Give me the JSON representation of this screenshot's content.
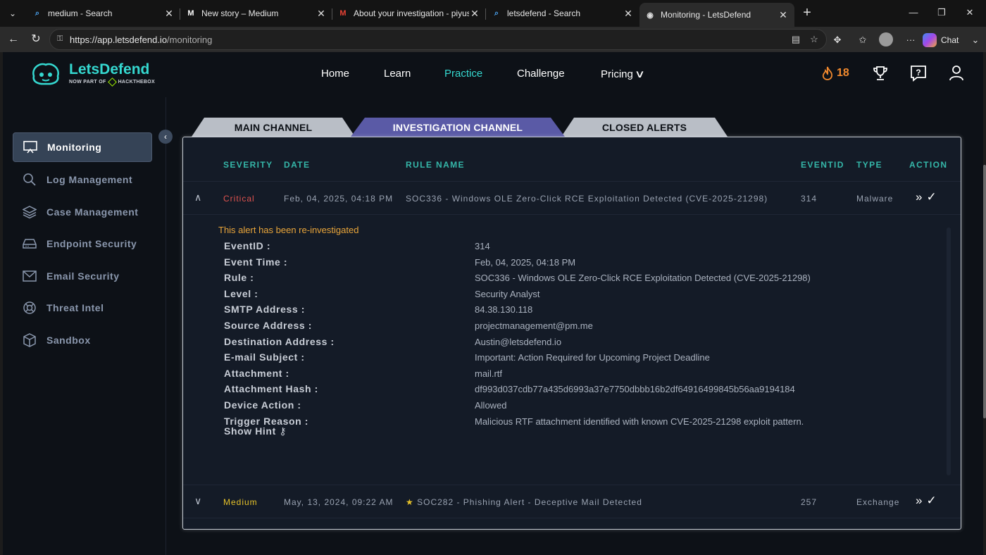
{
  "browser": {
    "tabs": [
      {
        "title": "medium - Search",
        "icon": "search-icon"
      },
      {
        "title": "New story – Medium",
        "icon": "medium-icon"
      },
      {
        "title": "About your investigation - piyusho",
        "icon": "gmail-icon"
      },
      {
        "title": "letsdefend - Search",
        "icon": "search-icon"
      },
      {
        "title": "Monitoring - LetsDefend",
        "icon": "letsdefend-icon"
      }
    ],
    "url_host": "https://app.letsdefend.io",
    "url_path": "/monitoring",
    "chat_label": "Chat"
  },
  "app": {
    "brand": "LetsDefend",
    "brand_sub_prefix": "NOW PART OF",
    "brand_sub_suffix": "HACKTHEBOX",
    "nav": {
      "home": "Home",
      "learn": "Learn",
      "practice": "Practice",
      "challenge": "Challenge",
      "pricing": "Pricing"
    },
    "streak": "18",
    "accent": "#35d8d0"
  },
  "sidebar": {
    "items": [
      {
        "label": "Monitoring",
        "icon": "monitor-icon"
      },
      {
        "label": "Log Management",
        "icon": "search-icon"
      },
      {
        "label": "Case Management",
        "icon": "layers-icon"
      },
      {
        "label": "Endpoint Security",
        "icon": "drive-icon"
      },
      {
        "label": "Email Security",
        "icon": "mail-icon"
      },
      {
        "label": "Threat Intel",
        "icon": "lifebuoy-icon"
      },
      {
        "label": "Sandbox",
        "icon": "cube-icon"
      }
    ]
  },
  "channels": {
    "main": "MAIN CHANNEL",
    "investigation": "INVESTIGATION CHANNEL",
    "closed": "CLOSED ALERTS"
  },
  "table": {
    "headers": {
      "severity": "SEVERITY",
      "date": "DATE",
      "rule": "RULE NAME",
      "eventid": "EVENTID",
      "type": "TYPE",
      "action": "ACTION"
    },
    "rows": [
      {
        "severity": "Critical",
        "date": "Feb, 04, 2025, 04:18 PM",
        "rule": "SOC336 - Windows OLE Zero-Click RCE Exploitation Detected (CVE-2025-21298)",
        "eventid": "314",
        "type": "Malware",
        "severity_color": "#e0534f"
      },
      {
        "severity": "Medium",
        "date": "May, 13, 2024, 09:22 AM",
        "rule": "SOC282 - Phishing Alert - Deceptive Mail Detected",
        "eventid": "257",
        "type": "Exchange",
        "severity_color": "#e6c229"
      }
    ]
  },
  "detail": {
    "notice": "This alert has been re-investigated",
    "fields": [
      {
        "label": "EventID :",
        "value": "314"
      },
      {
        "label": "Event Time :",
        "value": "Feb, 04, 2025, 04:18 PM"
      },
      {
        "label": "Rule :",
        "value": "SOC336 - Windows OLE Zero-Click RCE Exploitation Detected (CVE-2025-21298)"
      },
      {
        "label": "Level :",
        "value": "Security Analyst"
      },
      {
        "label": "SMTP Address :",
        "value": "84.38.130.118"
      },
      {
        "label": "Source Address :",
        "value": "projectmanagement@pm.me"
      },
      {
        "label": "Destination Address :",
        "value": "Austin@letsdefend.io"
      },
      {
        "label": "E-mail Subject :",
        "value": "Important: Action Required for Upcoming Project Deadline"
      },
      {
        "label": "Attachment :",
        "value": "mail.rtf"
      },
      {
        "label": "Attachment Hash :",
        "value": "df993d037cdb77a435d6993a37e7750dbbb16b2df64916499845b56aa9194184"
      },
      {
        "label": "Device Action :",
        "value": "Allowed"
      },
      {
        "label": "Trigger Reason :",
        "value": "Malicious RTF attachment identified with known CVE-2025-21298 exploit pattern."
      }
    ],
    "hint": "Show Hint"
  }
}
